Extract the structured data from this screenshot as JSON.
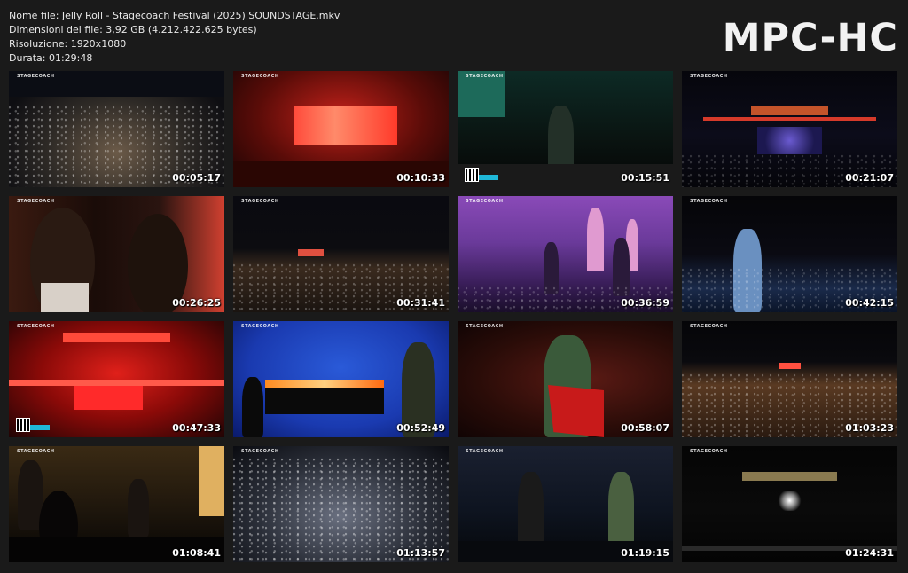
{
  "header": {
    "filename": "Nome file: Jelly Roll - Stagecoach Festival (2025) SOUNDSTAGE.mkv",
    "filesize": "Dimensioni del file: 3,92 GB (4.212.422.625 bytes)",
    "resolution": "Risoluzione: 1920x1080",
    "duration": "Durata: 01:29:48"
  },
  "brand": "MPC-HC",
  "overlay_logo": "STAGECOACH",
  "thumbnails": [
    {
      "time": "00:05:17",
      "scene": "aerial-night-crowd"
    },
    {
      "time": "00:10:33",
      "scene": "red-stage-screen"
    },
    {
      "time": "00:15:51",
      "scene": "singer-green-stage"
    },
    {
      "time": "00:21:07",
      "scene": "mane-stage-wide"
    },
    {
      "time": "00:26:25",
      "scene": "closeup-red-mics"
    },
    {
      "time": "00:31:41",
      "scene": "aerial-night-wide"
    },
    {
      "time": "00:36:59",
      "scene": "purple-cactus-stage"
    },
    {
      "time": "00:42:15",
      "scene": "singer-blue-crowd"
    },
    {
      "time": "00:47:33",
      "scene": "red-mane-stage"
    },
    {
      "time": "00:52:49",
      "scene": "fire-piano-blue"
    },
    {
      "time": "00:58:07",
      "scene": "singer-flag-red"
    },
    {
      "time": "01:03:23",
      "scene": "aerial-festival-night"
    },
    {
      "time": "01:08:41",
      "scene": "band-stage-amber"
    },
    {
      "time": "01:13:57",
      "scene": "aerial-crowd-lights"
    },
    {
      "time": "01:19:15",
      "scene": "two-singers-blue"
    },
    {
      "time": "01:24:31",
      "scene": "mane-stage-dark"
    }
  ]
}
